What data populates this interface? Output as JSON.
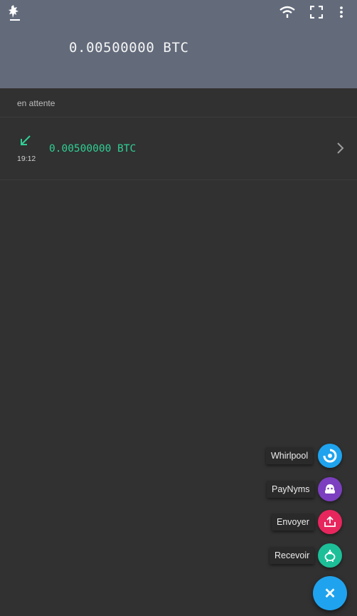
{
  "header": {
    "balance": "0.00500000 BTC",
    "icons": [
      "samourai-logo-icon",
      "wifi-icon",
      "fullscreen-icon",
      "more-vert-icon"
    ],
    "background_color": "#636b7b"
  },
  "pending": {
    "section_label": "en attente",
    "transactions": [
      {
        "direction": "incoming",
        "time": "19:12",
        "amount": "0.00500000 BTC",
        "amount_color": "#2fcf95"
      }
    ]
  },
  "fab_menu": {
    "items": [
      {
        "label": "Whirlpool",
        "icon": "whirlpool-icon",
        "color": "#1fa3ee"
      },
      {
        "label": "PayNyms",
        "icon": "paynym-icon",
        "color": "#7b3fbf"
      },
      {
        "label": "Envoyer",
        "icon": "send-icon",
        "color": "#e8265e"
      },
      {
        "label": "Recevoir",
        "icon": "receive-icon",
        "color": "#1dbf98"
      }
    ],
    "close_symbol": "✕",
    "main_color": "#1fa3ee"
  }
}
